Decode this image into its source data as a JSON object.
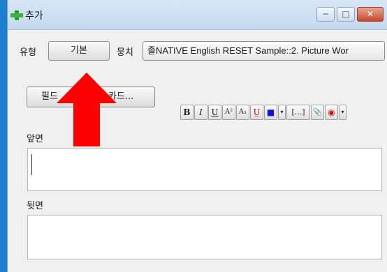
{
  "window": {
    "title": "추가",
    "controls": {
      "minimize": "−",
      "maximize": "□",
      "close": "✕"
    }
  },
  "type_row": {
    "type_label": "유형",
    "type_value": "기본",
    "deck_label": "뭉치",
    "deck_value": "졸NATIVE English RESET Sample::2. Picture Wor"
  },
  "toolbar": {
    "fields_button_label": "필드",
    "cards_button_label": "카드...",
    "format_buttons": [
      "B",
      "I",
      "U",
      "A²",
      "A₁",
      "U̲",
      "■",
      "▾",
      "[...]",
      "📎",
      "◉",
      "▾"
    ]
  },
  "fields": [
    {
      "label": "앞면",
      "value": ""
    },
    {
      "label": "뒷면",
      "value": ""
    }
  ],
  "colors": {
    "desktop": "#1d7fd0",
    "arrow": "#ff0000",
    "text_color_swatch": "#1010e0"
  }
}
